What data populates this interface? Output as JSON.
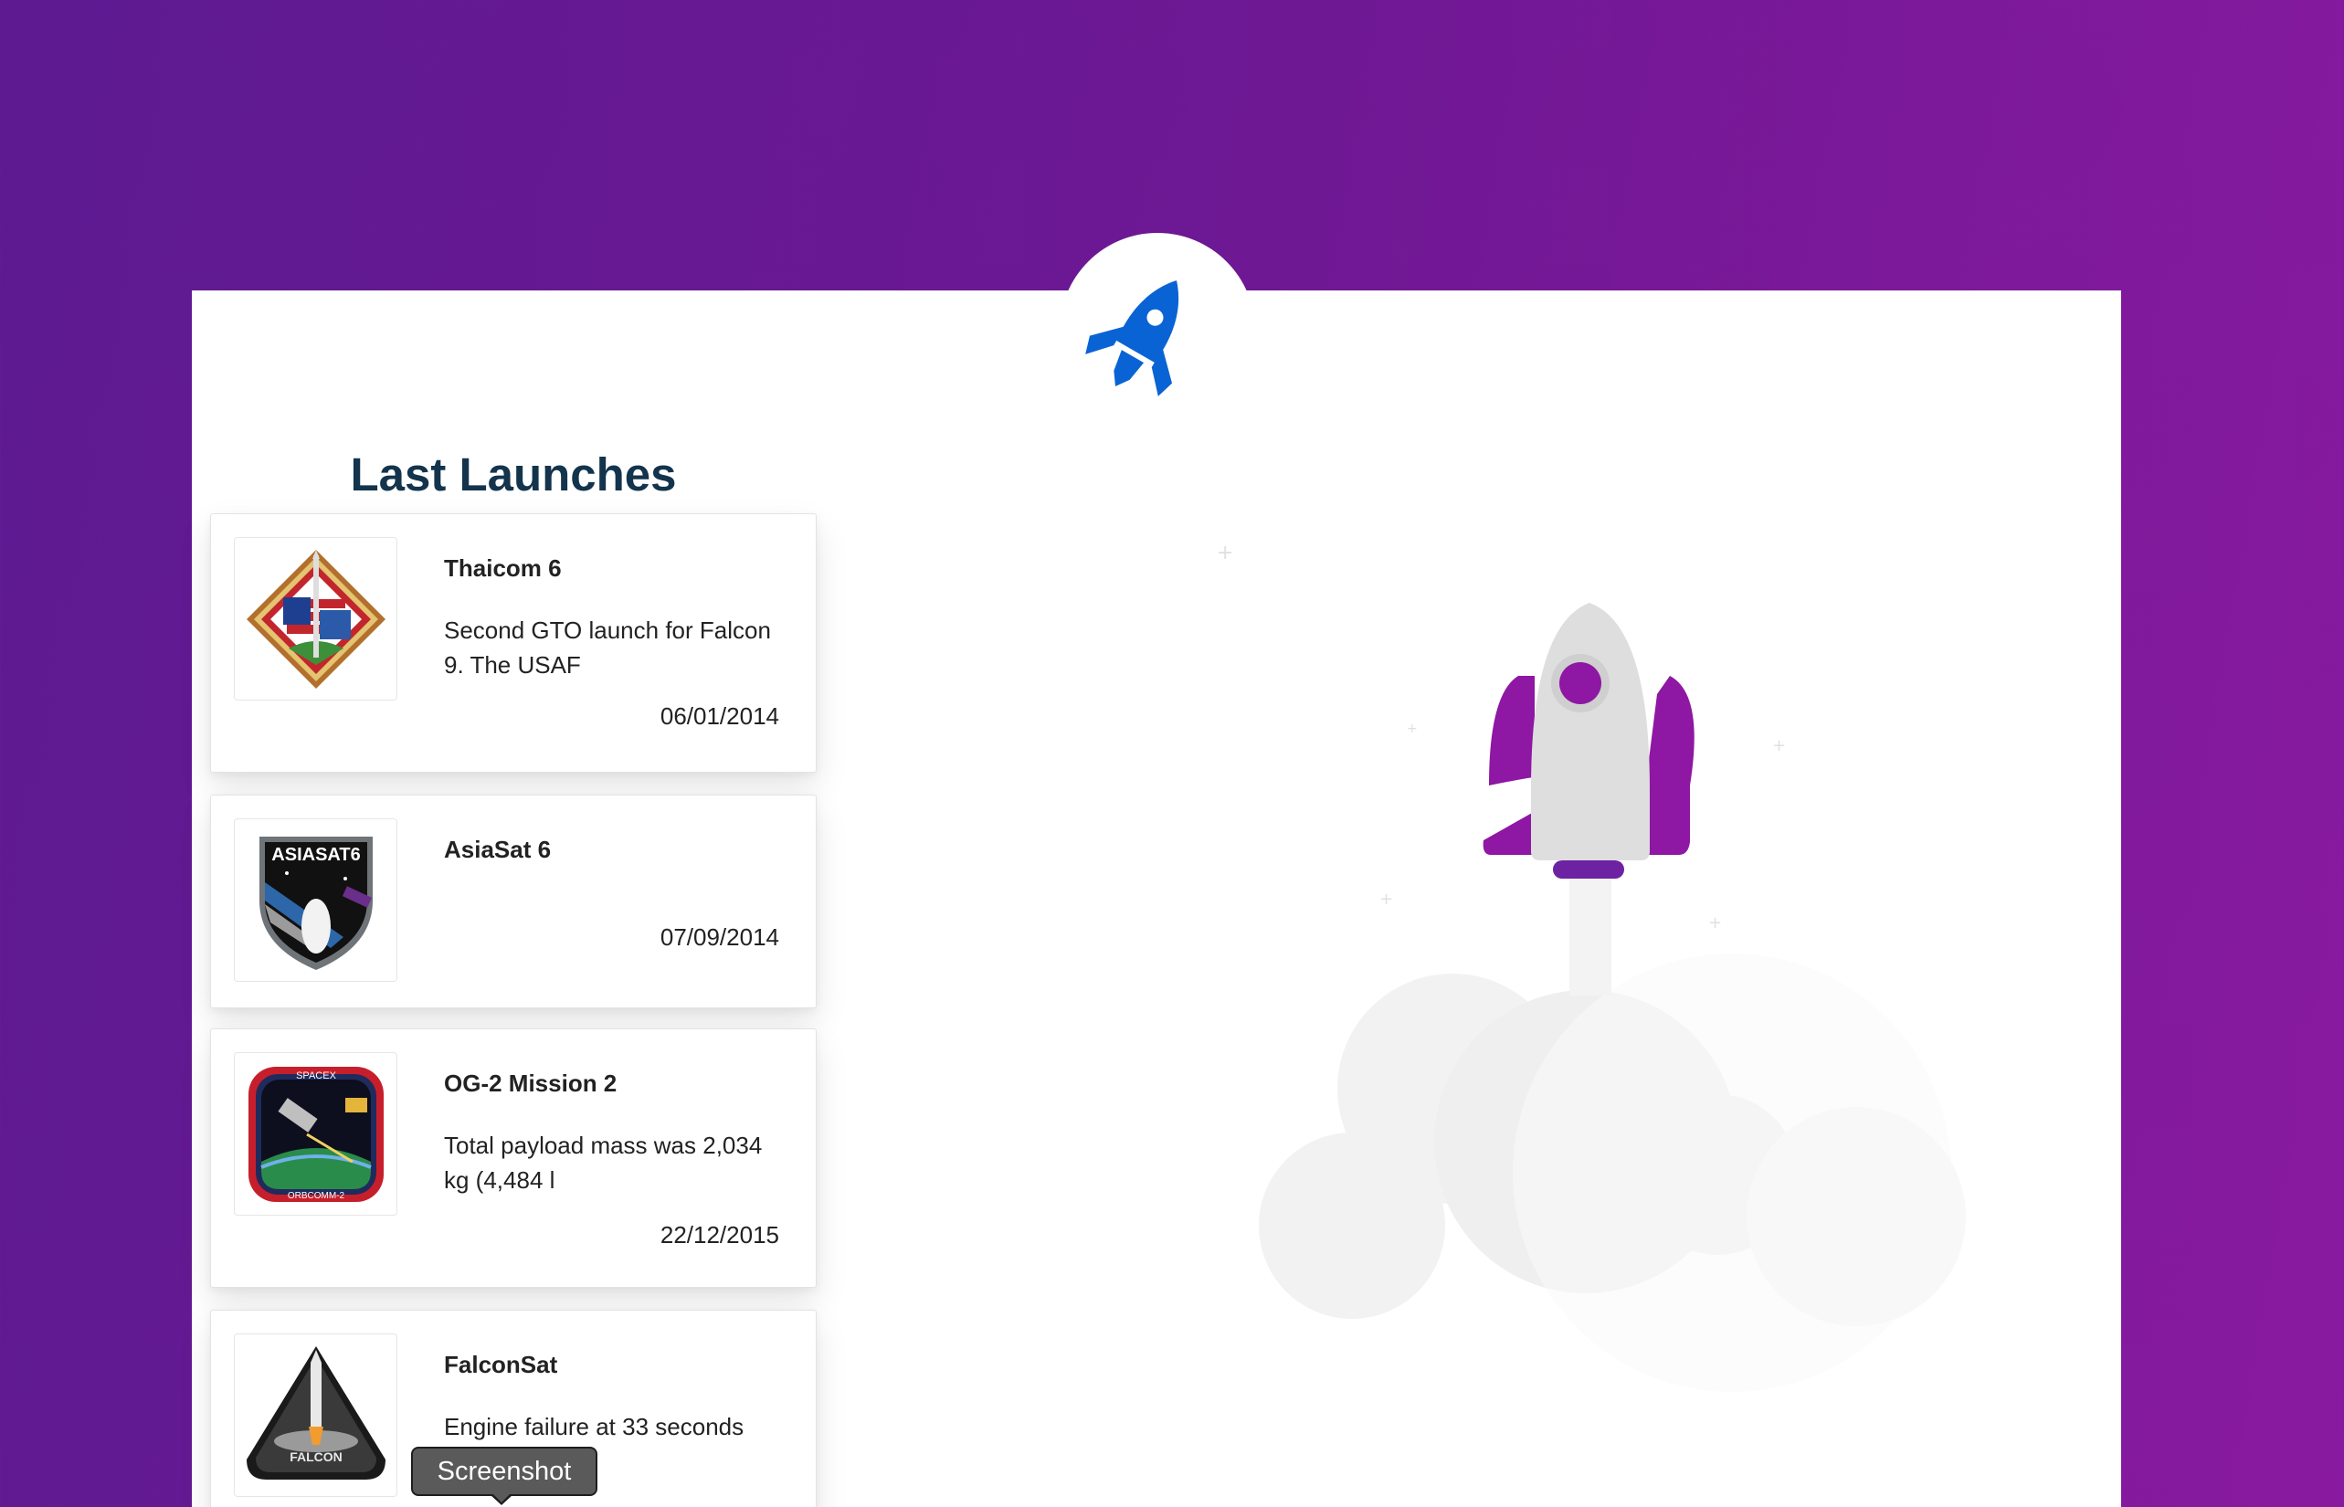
{
  "page": {
    "section_title": "Last Launches"
  },
  "colors": {
    "background_start": "#5d1a91",
    "background_end": "#891aa0",
    "card_background": "#ffffff",
    "title_color": "#13344c",
    "logo_rocket": "#0a63d4",
    "illustration_rocket_wings": "#8e17a3",
    "illustration_rocket_body": "#dedede",
    "illustration_cloud": "#f3f3f3"
  },
  "logo": {
    "icon": "rocket-icon"
  },
  "launches": [
    {
      "name": "Thaicom 6",
      "description": "Second GTO launch for Falcon 9. The USAF",
      "date": "06/01/2014",
      "patch_icon": "thaicom-6-mission-patch"
    },
    {
      "name": "AsiaSat 6",
      "description": "",
      "date": "07/09/2014",
      "patch_icon": "asiasat-6-mission-patch",
      "patch_text": "ASIASAT6"
    },
    {
      "name": "OG-2 Mission 2",
      "description": "Total payload mass was 2,034 kg (4,484 l",
      "date": "22/12/2015",
      "patch_icon": "orbcomm-2-mission-patch",
      "patch_text_top": "SPACEX",
      "patch_text_bottom": "ORBCOMM-2"
    },
    {
      "name": "FalconSat",
      "description": "Engine failure at 33 seconds",
      "date": "",
      "patch_icon": "falconsat-mission-patch",
      "patch_text": "FALCON"
    }
  ],
  "tooltip": {
    "label": "Screenshot"
  }
}
